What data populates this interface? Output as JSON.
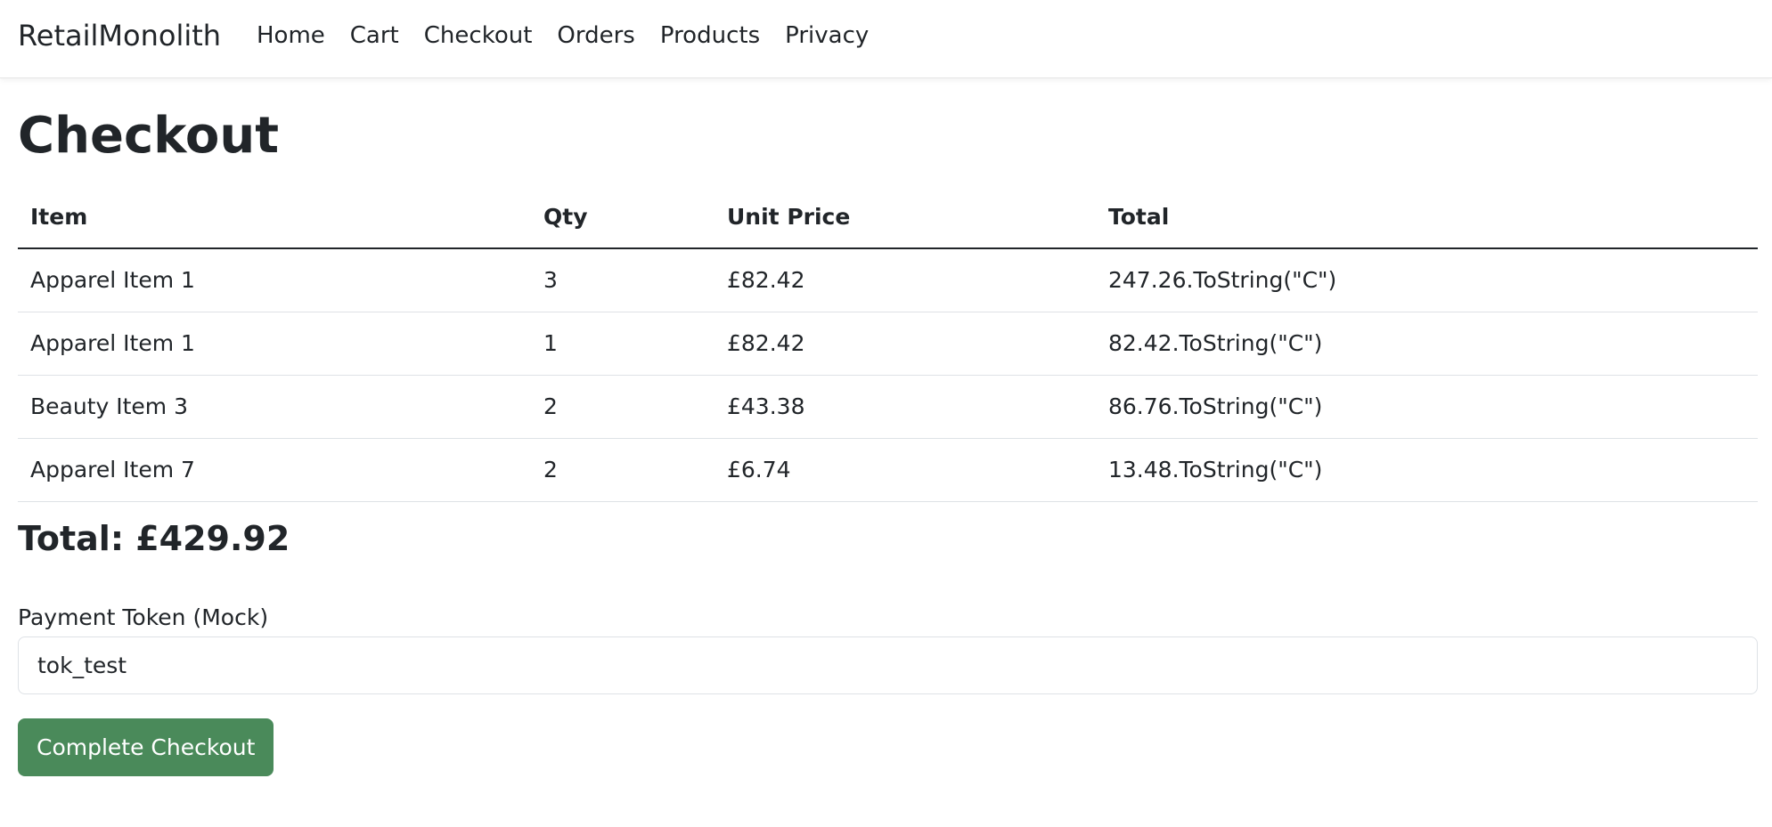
{
  "brand": "RetailMonolith",
  "nav": [
    "Home",
    "Cart",
    "Checkout",
    "Orders",
    "Products",
    "Privacy"
  ],
  "page_title": "Checkout",
  "table": {
    "headers": [
      "Item",
      "Qty",
      "Unit Price",
      "Total"
    ],
    "rows": [
      [
        "Apparel Item 1",
        "3",
        "£82.42",
        "247.26.ToString(\"C\")"
      ],
      [
        "Apparel Item 1",
        "1",
        "£82.42",
        "82.42.ToString(\"C\")"
      ],
      [
        "Beauty Item 3",
        "2",
        "£43.38",
        "86.76.ToString(\"C\")"
      ],
      [
        "Apparel Item 7",
        "2",
        "£6.74",
        "13.48.ToString(\"C\")"
      ]
    ]
  },
  "total_text": "Total: £429.92",
  "payment": {
    "label": "Payment Token (Mock)",
    "value": "tok_test"
  },
  "submit_label": "Complete Checkout",
  "colors": {
    "primary_button": "#4a8a5a",
    "text": "#212529"
  }
}
